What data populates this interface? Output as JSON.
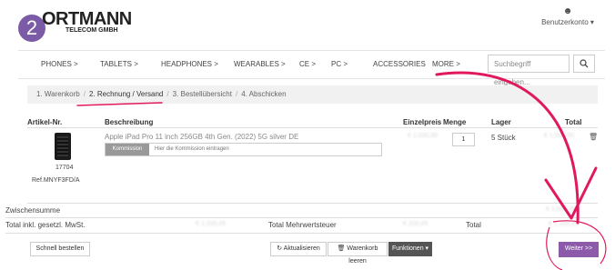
{
  "header": {
    "badge": "2",
    "logo_main": "ORTMANN",
    "logo_sub": "TELECOM GMBH",
    "account_label": "Benutzerkonto ▾"
  },
  "nav": {
    "items": [
      "PHONES >",
      "TABLETS >",
      "HEADPHONES >",
      "WEARABLES >",
      "CE >",
      "PC >",
      "ACCESSORIES",
      "MORE >"
    ],
    "search_placeholder": "Suchbegriff eingeben..."
  },
  "breadcrumb": {
    "steps": [
      "1. Warenkorb",
      "2. Rechnung / Versand",
      "3. Bestellübersicht",
      "4. Abschicken"
    ],
    "active_index": 1
  },
  "table": {
    "headers": {
      "article": "Artikel-Nr.",
      "description": "Beschreibung",
      "unit_price": "Einzelpreis",
      "quantity": "Menge",
      "stock": "Lager",
      "total": "Total"
    },
    "item": {
      "article_number": "17704",
      "ref": "Ref.MNYF3FD/A",
      "description": "Apple iPad Pro 11 inch 256GB 4th Gen. (2022) 5G silver DE",
      "kommission_label": "Kommission",
      "kommission_placeholder": "Hier die Kommission eintragen",
      "unit_price": "€ 1.000,00",
      "quantity": "1",
      "stock": "5 Stück",
      "total": "€ 1.000,00"
    }
  },
  "summary": {
    "subtotal_label": "Zwischensumme",
    "subtotal_value": "€ 1.000,00",
    "total_incl_label": "Total inkl. gesetzl. MwSt.",
    "total_incl_value": "€ 1.200,45",
    "vat_label": "Total Mehrwertsteuer",
    "vat_value": "€ 200,45",
    "total_label": "Total",
    "total_value": "€ 1.200,45"
  },
  "actions": {
    "quick_order": "Schnell bestellen",
    "refresh": "Aktualisieren",
    "empty_cart": "Warenkorb leeren",
    "functions": "Funktionen ▾",
    "next": "Weiter >>"
  },
  "colors": {
    "accent": "#8b5aa8",
    "annotation": "#e0195f",
    "badge": "#7b5aa6"
  }
}
